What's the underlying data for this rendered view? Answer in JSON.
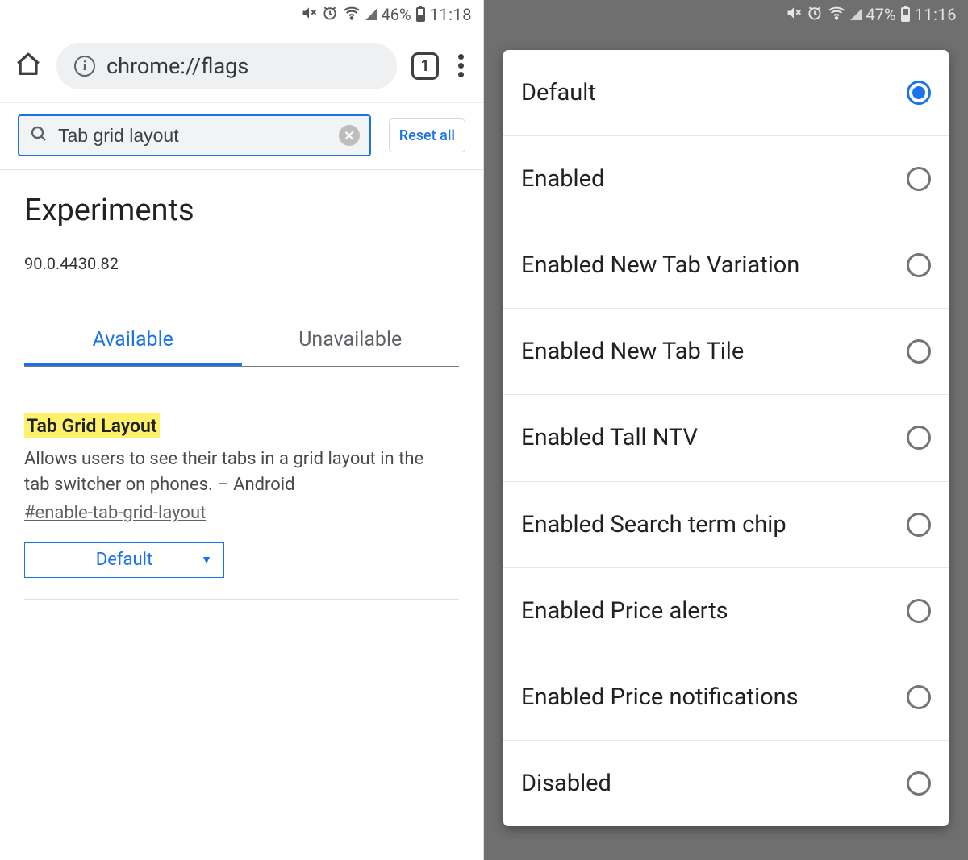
{
  "left": {
    "status": {
      "battery_pct": "46%",
      "time": "11:18"
    },
    "chrome": {
      "url": "chrome://flags",
      "tab_count": "1"
    },
    "search": {
      "value": "Tab grid layout",
      "reset_label": "Reset all"
    },
    "page_title": "Experiments",
    "version": "90.0.4430.82",
    "tabs": {
      "available": "Available",
      "unavailable": "Unavailable"
    },
    "flag": {
      "title": "Tab Grid Layout",
      "description": "Allows users to see their tabs in a grid layout in the tab switcher on phones. – Android",
      "anchor": "#enable-tab-grid-layout",
      "select_value": "Default"
    }
  },
  "right": {
    "status": {
      "battery_pct": "47%",
      "time": "11:16"
    },
    "options": [
      {
        "label": "Default",
        "selected": true
      },
      {
        "label": "Enabled",
        "selected": false
      },
      {
        "label": "Enabled New Tab Variation",
        "selected": false
      },
      {
        "label": "Enabled New Tab Tile",
        "selected": false
      },
      {
        "label": "Enabled Tall NTV",
        "selected": false
      },
      {
        "label": "Enabled Search term chip",
        "selected": false
      },
      {
        "label": "Enabled Price alerts",
        "selected": false
      },
      {
        "label": "Enabled Price notifications",
        "selected": false
      },
      {
        "label": "Disabled",
        "selected": false
      }
    ]
  }
}
